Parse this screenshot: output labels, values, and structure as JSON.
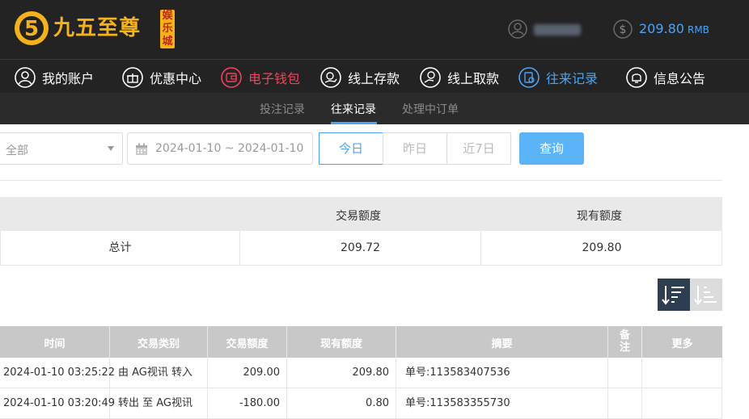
{
  "brand": {
    "logo_text": "九五至尊",
    "badge": [
      "娱",
      "乐",
      "城"
    ]
  },
  "account": {
    "balance": "209.80",
    "currency": "RMB"
  },
  "nav": {
    "items": [
      {
        "label": "我的账户",
        "icon": "user-icon"
      },
      {
        "label": "优惠中心",
        "icon": "gift-icon"
      },
      {
        "label": "电子钱包",
        "icon": "wallet-icon"
      },
      {
        "label": "线上存款",
        "icon": "deposit-icon"
      },
      {
        "label": "线上取款",
        "icon": "withdraw-icon"
      },
      {
        "label": "往来记录",
        "icon": "records-icon"
      },
      {
        "label": "信息公告",
        "icon": "bell-icon"
      }
    ],
    "highlight_color": "#f0445c",
    "active_color": "#4aa3f5"
  },
  "subnav": {
    "items": [
      "投注记录",
      "往来记录",
      "处理中订单"
    ],
    "active": "往来记录"
  },
  "filters": {
    "type_select": "全部",
    "date_range": "2024-01-10 ~ 2024-01-10",
    "quick": [
      "今日",
      "昨日",
      "近7日"
    ],
    "quick_active": "今日",
    "search_label": "查询"
  },
  "summary": {
    "headers": [
      "",
      "交易额度",
      "现有额度"
    ],
    "row": {
      "label": "总计",
      "amount": "209.72",
      "balance": "209.80"
    }
  },
  "table": {
    "headers": {
      "time": "时间",
      "type": "交易类别",
      "amount": "交易额度",
      "balance": "现有额度",
      "summary": "摘要",
      "remark": [
        "备",
        "注"
      ],
      "more": "更多"
    },
    "rows": [
      {
        "time": "2024-01-10 03:25:22",
        "type": "由 AG视讯 转入",
        "amount": "209.00",
        "balance": "209.80",
        "summary": "单号:113583407536"
      },
      {
        "time": "2024-01-10 03:20:49",
        "type": "转出 至 AG视讯",
        "amount": "-180.00",
        "balance": "0.80",
        "summary": "单号:113583355730"
      }
    ]
  }
}
